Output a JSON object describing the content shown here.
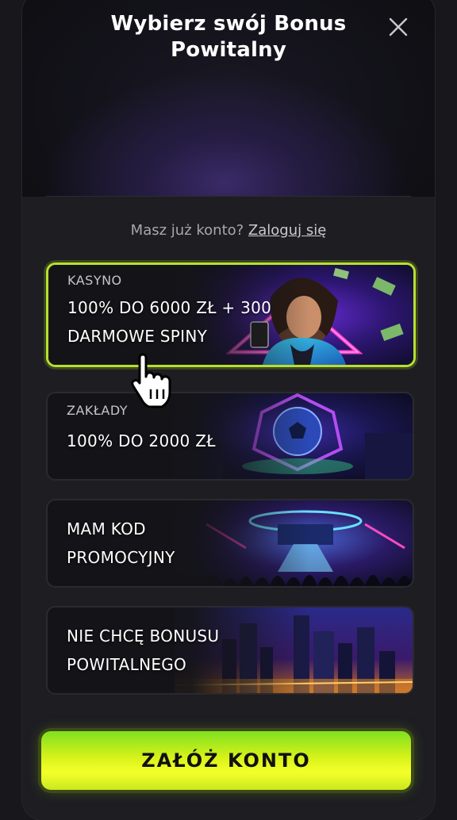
{
  "modal": {
    "title_line1": "Wybierz swój Bonus",
    "title_line2": "Powitalny",
    "close_icon": "close-icon"
  },
  "login": {
    "prompt": "Masz już konto?",
    "link": "Zaloguj się"
  },
  "options": [
    {
      "label": "KASYNO",
      "line1": "100% DO 6000 ZŁ + 300",
      "line2": "DARMOWE SPINY",
      "selected": true,
      "art": "casino-woman-art"
    },
    {
      "label": "ZAKŁADY",
      "line1": "100% DO 2000 ZŁ",
      "selected": false,
      "art": "soccer-ball-art"
    },
    {
      "line1": "MAM KOD",
      "line2": "PROMOCYJNY",
      "selected": false,
      "art": "stadium-art"
    },
    {
      "line1": "NIE CHCĘ BONUSU",
      "line2": "POWITALNEGO",
      "selected": false,
      "art": "city-night-art"
    }
  ],
  "cta": {
    "label": "ZAŁÓŻ KONTO"
  },
  "colors": {
    "accent": "#b5e02e",
    "cta_top": "#7fe020",
    "cta_mid": "#f4ff2a",
    "background": "#1d1d22"
  },
  "cursor_icon": "hand-pointer-icon"
}
